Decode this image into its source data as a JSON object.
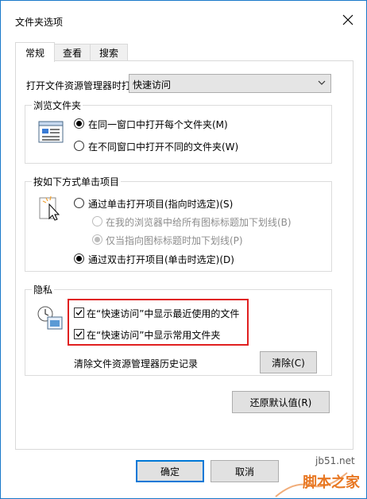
{
  "window": {
    "title": "文件夹选项",
    "close_glyph": "✕"
  },
  "tabs": [
    {
      "label": "常规",
      "active": true
    },
    {
      "label": "查看",
      "active": false
    },
    {
      "label": "搜索",
      "active": false
    }
  ],
  "open_in": {
    "label": "打开文件资源管理器时打",
    "value": "快速访问",
    "arrow": "⌄"
  },
  "browse_folders": {
    "title": "浏览文件夹",
    "options": [
      {
        "label": "在同一窗口中打开每个文件夹(M)",
        "checked": true
      },
      {
        "label": "在不同窗口中打开不同的文件夹(W)",
        "checked": false
      }
    ]
  },
  "click_items": {
    "title": "按如下方式单击项目",
    "options": [
      {
        "label": "通过单击打开项目(指向时选定)(S)",
        "checked": false
      },
      {
        "label": "在我的浏览器中给所有图标标题加下划线(B)",
        "checked": false,
        "disabled": true
      },
      {
        "label": "仅当指向图标标题时加下划线(P)",
        "checked": true,
        "disabled": true
      },
      {
        "label": "通过双击打开项目(单击时选定)(D)",
        "checked": true
      }
    ]
  },
  "privacy": {
    "title": "隐私",
    "checkboxes": [
      {
        "label": "在“快速访问”中显示最近使用的文件",
        "checked": true
      },
      {
        "label": "在“快速访问”中显示常用文件夹",
        "checked": true
      }
    ],
    "clear_history_label": "清除文件资源管理器历史记录",
    "clear_button": "清除(C)"
  },
  "restore_defaults_button": "还原默认值(R)",
  "footer": {
    "ok": "确定",
    "cancel": "取消"
  },
  "watermark": {
    "site": "jb51.net",
    "brand": "脚本之家"
  },
  "colors": {
    "accent": "#0078d7",
    "highlight": "#e02020",
    "watermark": "#e87722"
  }
}
